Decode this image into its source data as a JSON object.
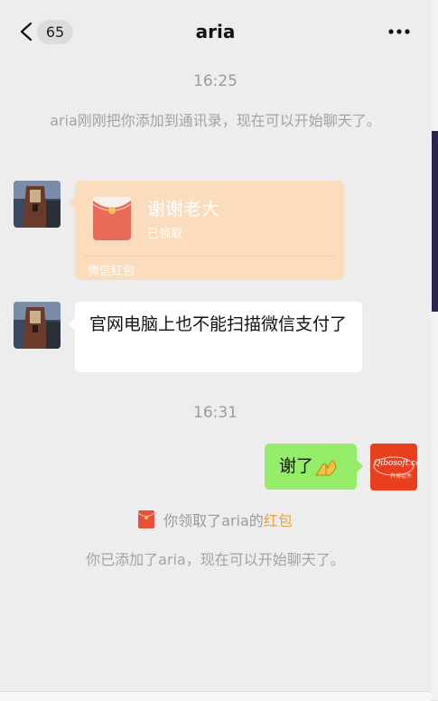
{
  "header": {
    "badge_count": "65",
    "title": "aria"
  },
  "messages": {
    "timestamp_1": "16:25",
    "system_1": "aria刚刚把你添加到通讯录，现在可以开始聊天了。",
    "red_packet": {
      "title": "谢谢老大",
      "status": "已领取",
      "footer": "微信红包"
    },
    "incoming_text": "官网电脑上也不能扫描微信支付了",
    "timestamp_2": "16:31",
    "outgoing_text": "谢了",
    "outgoing_emoji": "clasped-hands-emoji",
    "self_avatar_logo": "Qibosoft.com",
    "self_avatar_sub": "齐博软件",
    "received_notice": {
      "prefix": "你领取了aria的",
      "link": "红包"
    },
    "system_2": "你已添加了aria，现在可以开始聊天了。"
  },
  "colors": {
    "background": "#ededed",
    "outgoing_bubble": "#95ec69",
    "red_packet_card": "#fbdcbd",
    "red_packet_link": "#f0a040"
  }
}
